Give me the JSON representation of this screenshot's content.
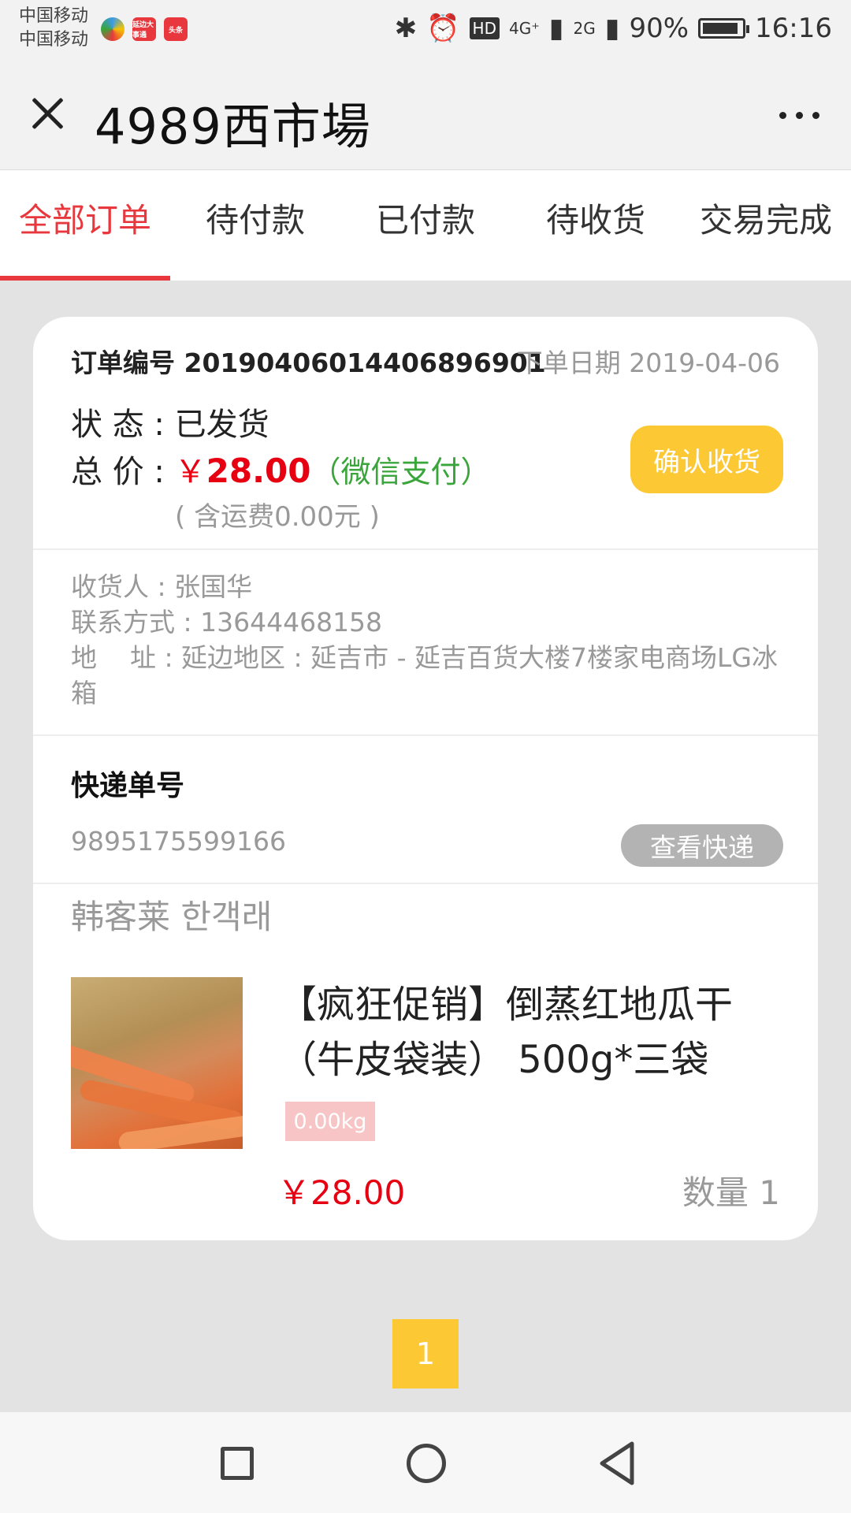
{
  "status_bar": {
    "carrier1": "中国移动",
    "carrier2": "中国移动",
    "app_badge1": "延边大事通",
    "app_badge2": "头条",
    "network": "4G⁺",
    "network2": "2G",
    "battery": "90%",
    "time": "16:16"
  },
  "title_bar": {
    "title": "4989西市場"
  },
  "tabs": [
    {
      "label": "全部订单",
      "active": true
    },
    {
      "label": "待付款",
      "active": false
    },
    {
      "label": "已付款",
      "active": false
    },
    {
      "label": "待收货",
      "active": false
    },
    {
      "label": "交易完成",
      "active": false
    }
  ],
  "order": {
    "order_no": "订单编号 20190406014406896901",
    "order_date": "下单日期 2019-04-06",
    "status_label": "状 态 : ",
    "status_value": "已发货",
    "price_label": "总 价 : ",
    "currency": "￥",
    "total_price": "28.00",
    "pay_method": "（微信支付）",
    "shipping_note": "( 含运费0.00元 )",
    "confirm_button": "确认收货"
  },
  "receiver": {
    "name_line": "收货人 : 张国华",
    "contact_line": "联系方式 : 13644468158",
    "address_line": "地    址 : 延边地区 : 延吉市 - 延吉百货大楼7楼家电商场LG冰箱"
  },
  "express": {
    "title": "快递单号",
    "number": "9895175599166",
    "track_button": "查看快递"
  },
  "product": {
    "shop_name": "韩客莱 한객래",
    "name": "【疯狂促销】倒蒸红地瓜干（牛皮袋装） 500g*三袋",
    "weight": "0.00kg",
    "price": "￥28.00",
    "quantity": "数量 1"
  },
  "pagination": {
    "current_page": "1"
  },
  "colors": {
    "accent_red": "#e8383d",
    "price_red": "#e60012",
    "button_yellow": "#fcc935",
    "pay_green": "#3aa53a"
  }
}
